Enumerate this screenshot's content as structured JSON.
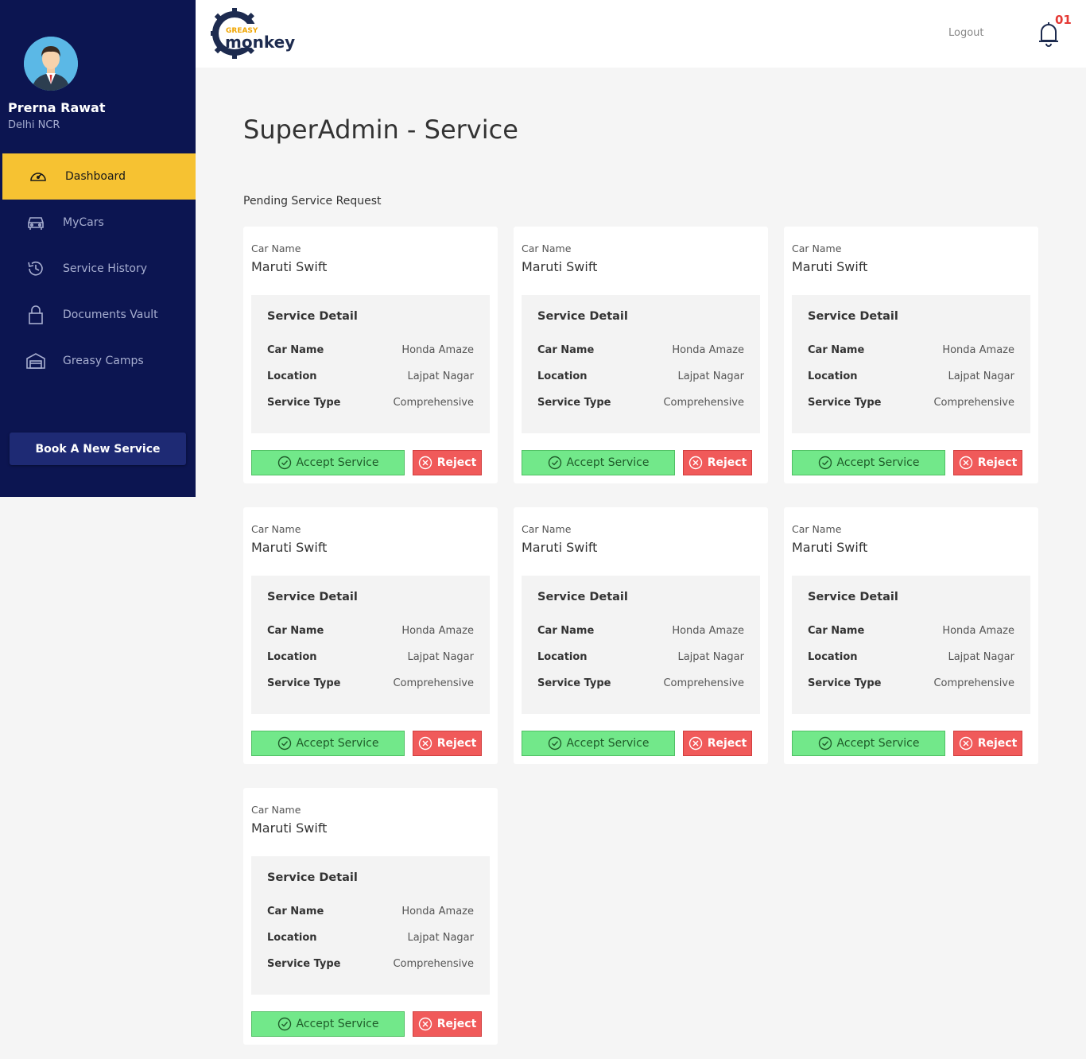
{
  "user": {
    "name": "Prerna Rawat",
    "location": "Delhi NCR"
  },
  "nav": [
    {
      "label": "Dashboard",
      "icon": "speedometer-icon",
      "active": true
    },
    {
      "label": "MyCars",
      "icon": "car-icon"
    },
    {
      "label": "Service History",
      "icon": "history-icon"
    },
    {
      "label": "Documents Vault",
      "icon": "lock-icon"
    },
    {
      "label": "Greasy Camps",
      "icon": "garage-icon"
    }
  ],
  "book_button": "Book A New Service",
  "header": {
    "logo_top": "GREASY",
    "logo_main": "monkey",
    "logout": "Logout",
    "notification_count": "01"
  },
  "page_title": "SuperAdmin - Service",
  "section_title": "Pending Service Request",
  "cards": [
    {
      "car_name_label": "Car Name",
      "car_name": "Maruti Swift",
      "detail_title": "Service Detail",
      "rows": [
        {
          "key": "Car Name",
          "value": "Honda Amaze"
        },
        {
          "key": "Location",
          "value": "Lajpat Nagar"
        },
        {
          "key": "Service Type",
          "value": "Comprehensive"
        }
      ],
      "accept": "Accept Service",
      "reject": "Reject"
    },
    {
      "car_name_label": "Car Name",
      "car_name": "Maruti Swift",
      "detail_title": "Service Detail",
      "rows": [
        {
          "key": "Car Name",
          "value": "Honda Amaze"
        },
        {
          "key": "Location",
          "value": "Lajpat Nagar"
        },
        {
          "key": "Service Type",
          "value": "Comprehensive"
        }
      ],
      "accept": "Accept Service",
      "reject": "Reject"
    },
    {
      "car_name_label": "Car Name",
      "car_name": "Maruti Swift",
      "detail_title": "Service Detail",
      "rows": [
        {
          "key": "Car Name",
          "value": "Honda Amaze"
        },
        {
          "key": "Location",
          "value": "Lajpat Nagar"
        },
        {
          "key": "Service Type",
          "value": "Comprehensive"
        }
      ],
      "accept": "Accept Service",
      "reject": "Reject"
    },
    {
      "car_name_label": "Car Name",
      "car_name": "Maruti Swift",
      "detail_title": "Service Detail",
      "rows": [
        {
          "key": "Car Name",
          "value": "Honda Amaze"
        },
        {
          "key": "Location",
          "value": "Lajpat Nagar"
        },
        {
          "key": "Service Type",
          "value": "Comprehensive"
        }
      ],
      "accept": "Accept Service",
      "reject": "Reject"
    },
    {
      "car_name_label": "Car Name",
      "car_name": "Maruti Swift",
      "detail_title": "Service Detail",
      "rows": [
        {
          "key": "Car Name",
          "value": "Honda Amaze"
        },
        {
          "key": "Location",
          "value": "Lajpat Nagar"
        },
        {
          "key": "Service Type",
          "value": "Comprehensive"
        }
      ],
      "accept": "Accept Service",
      "reject": "Reject"
    },
    {
      "car_name_label": "Car Name",
      "car_name": "Maruti Swift",
      "detail_title": "Service Detail",
      "rows": [
        {
          "key": "Car Name",
          "value": "Honda Amaze"
        },
        {
          "key": "Location",
          "value": "Lajpat Nagar"
        },
        {
          "key": "Service Type",
          "value": "Comprehensive"
        }
      ],
      "accept": "Accept Service",
      "reject": "Reject"
    },
    {
      "car_name_label": "Car Name",
      "car_name": "Maruti Swift",
      "detail_title": "Service Detail",
      "rows": [
        {
          "key": "Car Name",
          "value": "Honda Amaze"
        },
        {
          "key": "Location",
          "value": "Lajpat Nagar"
        },
        {
          "key": "Service Type",
          "value": "Comprehensive"
        }
      ],
      "accept": "Accept Service",
      "reject": "Reject"
    }
  ],
  "colors": {
    "sidebar": "#0c1551",
    "active_nav": "#f6c232",
    "accept": "#72e88a",
    "reject": "#f05a5a",
    "badge": "#e53935"
  }
}
